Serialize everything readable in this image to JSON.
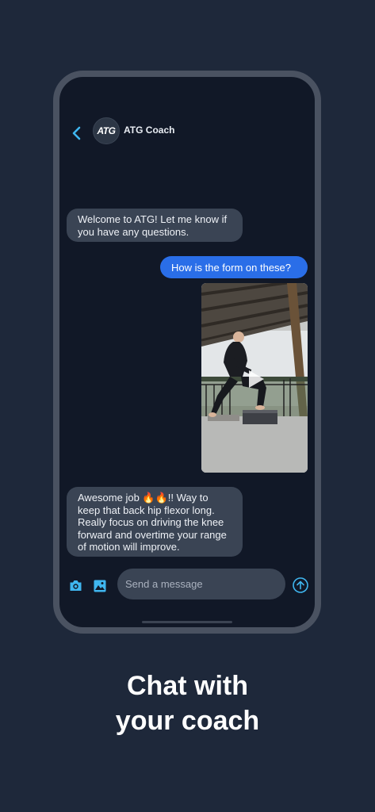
{
  "chat": {
    "coach_name": "ATG Coach",
    "avatar_text": "ATG",
    "messages": [
      {
        "from": "coach",
        "text": "Welcome to ATG! Let me know if you have any questions."
      },
      {
        "from": "user",
        "text": "How is the form on these?"
      },
      {
        "from": "user",
        "type": "video"
      },
      {
        "from": "coach",
        "text": "Awesome job 🔥🔥!! Way to keep that back hip flexor long. Really focus on driving the knee forward and overtime your range of motion will improve."
      }
    ]
  },
  "composer": {
    "placeholder": "Send a message",
    "icons": [
      "camera-icon",
      "image-icon",
      "send-arrow-icon"
    ]
  },
  "tagline": {
    "line1": "Chat with",
    "line2": "your coach"
  },
  "colors": {
    "background": "#1e283a",
    "screen": "#111827",
    "incoming_bubble": "#3a4454",
    "outgoing_bubble": "#2a6ee8",
    "accent": "#3fb6ef"
  }
}
